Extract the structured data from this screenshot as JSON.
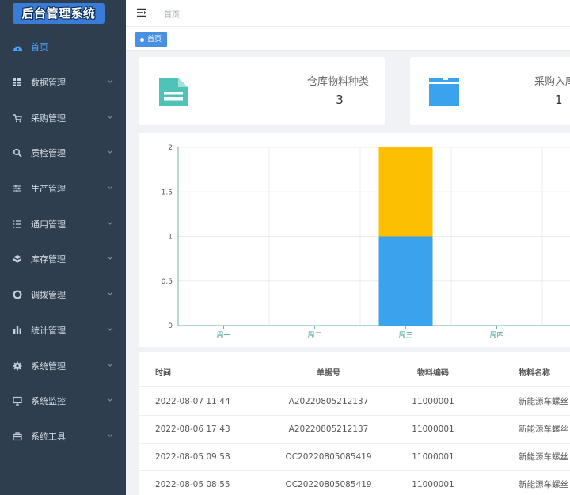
{
  "app": {
    "logo_text": "后台管理系统"
  },
  "colors": {
    "sidebar_bg": "#2f3e4f",
    "accent": "#4a90e2",
    "teal": "#4fc3b7",
    "blue": "#3ba2ee",
    "yellow": "#fdbf01"
  },
  "sidebar": {
    "items": [
      {
        "label": "首页",
        "icon": "dashboard-icon",
        "active": true
      },
      {
        "label": "数据管理",
        "icon": "database-icon"
      },
      {
        "label": "采购管理",
        "icon": "cart-icon"
      },
      {
        "label": "质检管理",
        "icon": "search-icon"
      },
      {
        "label": "生产管理",
        "icon": "sliders-icon"
      },
      {
        "label": "通用管理",
        "icon": "list-icon"
      },
      {
        "label": "库存管理",
        "icon": "cube-icon"
      },
      {
        "label": "调拨管理",
        "icon": "lifebuoy-icon"
      },
      {
        "label": "统计管理",
        "icon": "bar-chart-icon"
      },
      {
        "label": "系统管理",
        "icon": "gear-icon"
      },
      {
        "label": "系统监控",
        "icon": "monitor-icon"
      },
      {
        "label": "系统工具",
        "icon": "toolbox-icon"
      }
    ]
  },
  "header": {
    "breadcrumb": "首页"
  },
  "tags": {
    "active_tag": "首页"
  },
  "cards": [
    {
      "title": "仓库物料种类",
      "value": "3",
      "icon": "document-icon"
    },
    {
      "title": "采购入库",
      "value": "1",
      "icon": "folder-icon"
    }
  ],
  "chart_data": {
    "type": "bar",
    "stacked": true,
    "categories": [
      "周一",
      "周二",
      "周三",
      "周四"
    ],
    "series": [
      {
        "color": "#3ba2ee",
        "values": [
          0,
          0,
          1,
          0
        ]
      },
      {
        "color": "#fdbf01",
        "values": [
          0,
          0,
          1,
          0
        ]
      }
    ],
    "ylim": [
      0,
      2
    ],
    "yticks": [
      "0",
      "0.5",
      "1",
      "1.5",
      "2"
    ],
    "grid": true
  },
  "table": {
    "headers": {
      "time": "时间",
      "order_no": "单据号",
      "code": "物料编码",
      "name": "物料名称"
    },
    "rows": [
      {
        "time": "2022-08-07 11:44",
        "order_no": "A20220805212137",
        "code": "11000001",
        "name": "新能源车螺丝"
      },
      {
        "time": "2022-08-06 17:43",
        "order_no": "A20220805212137",
        "code": "11000001",
        "name": "新能源车螺丝"
      },
      {
        "time": "2022-08-05 09:58",
        "order_no": "OC20220805085419",
        "code": "11000001",
        "name": "新能源车螺丝"
      },
      {
        "time": "2022-08-05 08:55",
        "order_no": "OC20220805085419",
        "code": "11000001",
        "name": "新能源车螺丝"
      }
    ]
  }
}
